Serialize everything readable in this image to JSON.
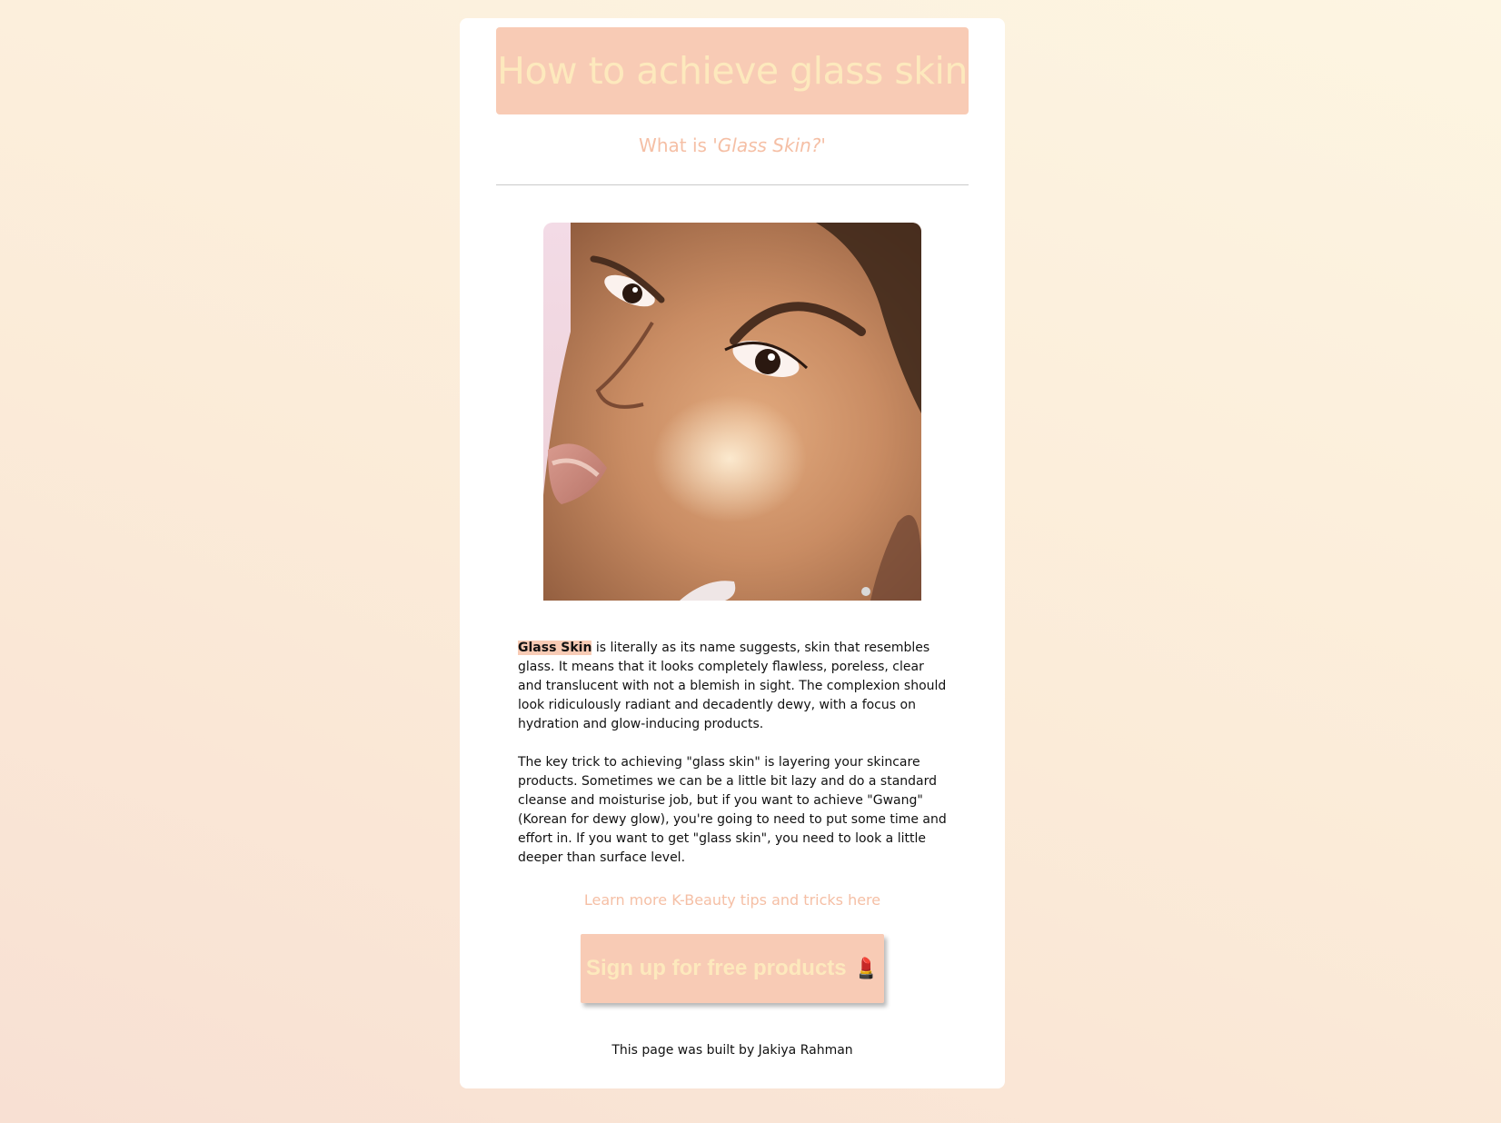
{
  "header": {
    "title": "How to achieve glass skin",
    "subtitle_prefix": "What is ",
    "subtitle_emphasis": "'Glass Skin?'"
  },
  "hero_image": {
    "alt": "Close-up portrait showing dewy glass skin"
  },
  "article": {
    "paragraph1_highlight": "Glass Skin",
    "paragraph1_rest": " is literally as its name suggests, skin that resembles glass. It means that it looks completely flawless, poreless, clear and translucent with not a blemish in sight. The complexion should look ridiculously radiant and decadently dewy, with a focus on hydration and glow-inducing products.",
    "paragraph2": "The key trick to achieving \"glass skin\" is layering your skincare products. Sometimes we can be a little bit lazy and do a standard cleanse and moisturise job, but if you want to achieve \"Gwang\" (Korean for dewy glow), you're going to need to put some time and effort in. If you want to get \"glass skin\", you need to look a little deeper than surface level."
  },
  "links": {
    "learn_more": "Learn more K-Beauty tips and tricks here"
  },
  "cta": {
    "label": "Sign up for free products",
    "icon": "💄",
    "icon_name": "lipstick-icon"
  },
  "footer": {
    "credit": "This page was built by Jakiya Rahman"
  },
  "colors": {
    "accent": "#f8cbb5",
    "title_text": "#fde9bd",
    "subtitle_text": "#f5bfa5"
  }
}
